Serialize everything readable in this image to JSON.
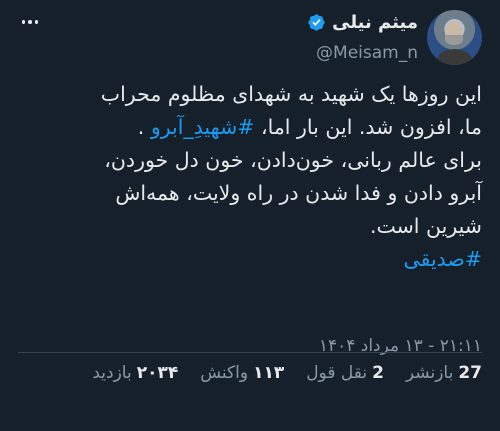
{
  "author": {
    "name": "میثم نیلی",
    "handle": "@Meisam_n"
  },
  "tweet": {
    "lines": [
      {
        "text": "این روزها یک شهید به شهدای مظلوم محراب"
      },
      {
        "text": "ما، افزون شد. این بار اما، ",
        "hashtag": "#شهیدِ_آبرو",
        "suffix": " ."
      },
      {
        "text": "برای عالم ربانی، خون‌دادن، خون دل خوردن،"
      },
      {
        "text": "آبرو دادن و فدا شدن در راه ولایت، همه‌اش"
      },
      {
        "text": "شیرین است."
      }
    ],
    "bottom_hashtag": "#صدیقی"
  },
  "timestamp": "۲۱:۱۱ - ۱۳ مرداد ۱۴۰۴",
  "stats": {
    "reposts": {
      "value": "27",
      "label": "بازنشر"
    },
    "quotes": {
      "value": "2",
      "label": "نقل قول"
    },
    "likes": {
      "value": "۱۱۳",
      "label": "واکنش"
    },
    "views": {
      "value": "۲۰۳۴",
      "label": "بازدید"
    }
  },
  "colors": {
    "background": "#15202b",
    "text": "#e7e9ea",
    "secondary": "#8b98a5",
    "link": "#1d9bf0",
    "verified": "#1d9bf0"
  },
  "icons": {
    "more": "more-horizontal-icon",
    "verified": "verified-badge-icon"
  }
}
